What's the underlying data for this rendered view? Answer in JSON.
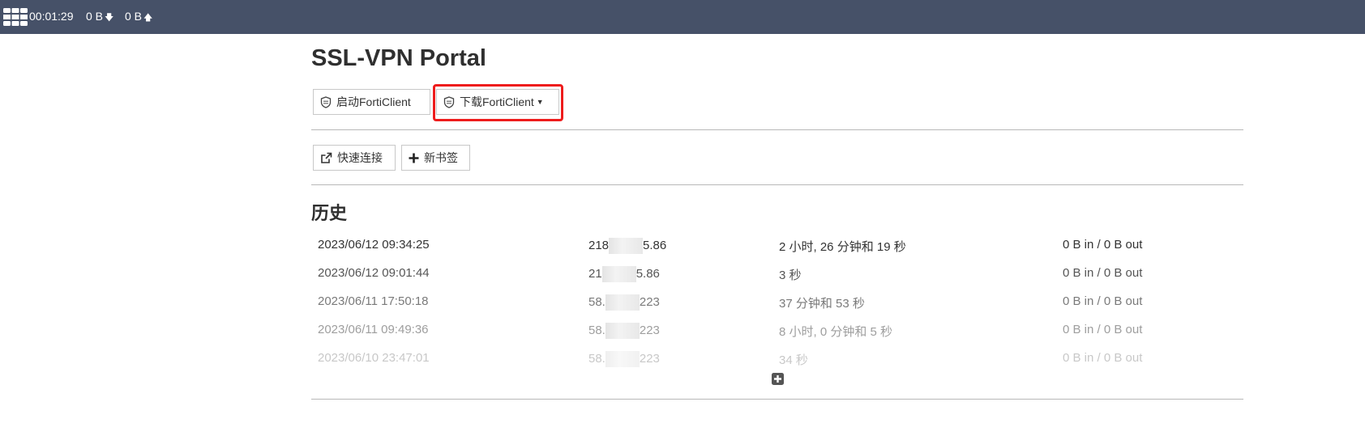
{
  "topbar": {
    "timer": "00:01:29",
    "download": "0 B",
    "upload": "0 B",
    "icons": [
      "fortinet-logo-icon",
      "arrow-down-icon",
      "arrow-up-icon"
    ]
  },
  "page": {
    "title": "SSL-VPN Portal"
  },
  "forticlient": {
    "launch_label": "启动FortiClient",
    "download_label": "下载FortiClient",
    "icon": "shield-icon"
  },
  "actions": {
    "quick_connect_label": "快速连接",
    "new_bookmark_label": "新书签",
    "icons": [
      "external-link-icon",
      "plus-icon"
    ]
  },
  "history": {
    "title": "历史",
    "rows": [
      {
        "time": "2023/06/12 09:34:25",
        "ip_start": "218",
        "ip_end": "5.86",
        "duration": "2 小时, 26 分钟和 19 秒",
        "traffic": "0 B in / 0 B out"
      },
      {
        "time": "2023/06/12 09:01:44",
        "ip_start": "21",
        "ip_end": "5.86",
        "duration": "3 秒",
        "traffic": "0 B in / 0 B out"
      },
      {
        "time": "2023/06/11 17:50:18",
        "ip_start": "58.",
        "ip_end": "223",
        "duration": "37 分钟和 53 秒",
        "traffic": "0 B in / 0 B out"
      },
      {
        "time": "2023/06/11 09:49:36",
        "ip_start": "58.",
        "ip_end": "223",
        "duration": "8 小时, 0 分钟和 5 秒",
        "traffic": "0 B in / 0 B out"
      },
      {
        "time": "2023/06/10 23:47:01",
        "ip_start": "58.",
        "ip_end": "223",
        "duration": "34 秒",
        "traffic": "0 B in / 0 B out"
      }
    ]
  },
  "colors": {
    "topbar": "#465168",
    "highlight": "#ee1c1c"
  }
}
